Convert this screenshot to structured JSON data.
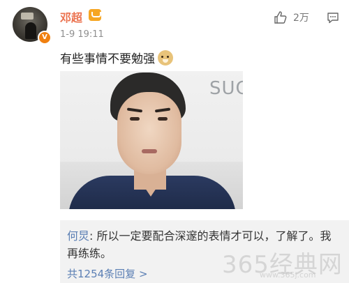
{
  "post": {
    "username": "邓超",
    "verified_badge": "V",
    "timestamp": "1-9 19:11",
    "text": "有些事情不要勉强",
    "emoji": "doge-emoji",
    "like_count": "2万",
    "photo_magazine_text": "SUC"
  },
  "comment": {
    "author": "何炅",
    "separator": ": ",
    "body": "所以一定要配合深邃的表情才可以，了解了。我再练练。",
    "more_replies": "共1254条回复 >"
  },
  "watermark": {
    "brand": "365经典网",
    "url": "www.365j.com"
  },
  "colors": {
    "username": "#eb7350",
    "link": "#5b7fb4",
    "timestamp": "#8f8f8f",
    "comment_bg": "#f2f2f2"
  }
}
